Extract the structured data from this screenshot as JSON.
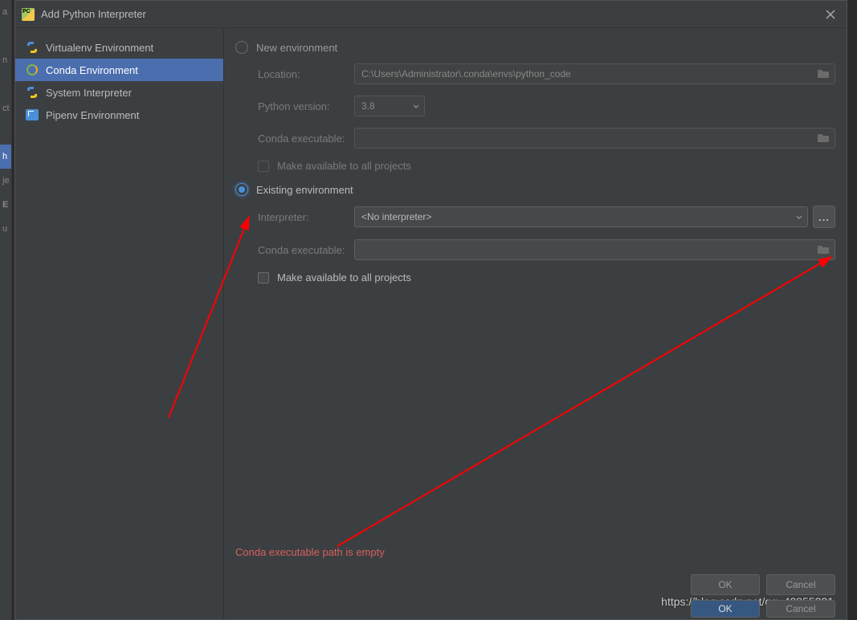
{
  "title": "Add Python Interpreter",
  "sidebar": {
    "items": [
      {
        "label": "Virtualenv Environment"
      },
      {
        "label": "Conda Environment"
      },
      {
        "label": "System Interpreter"
      },
      {
        "label": "Pipenv Environment"
      }
    ]
  },
  "radio": {
    "new_env": "New environment",
    "existing_env": "Existing environment"
  },
  "form": {
    "location_label": "Location:",
    "location_value": "C:\\Users\\Administrator\\.conda\\envs\\python_code",
    "pyver_label": "Python version:",
    "pyver_value": "3.8",
    "conda_exe_label": "Conda executable:",
    "conda_exe_value": "",
    "make_all_label": "Make available to all projects",
    "interpreter_label": "Interpreter:",
    "interpreter_value": "<No interpreter>",
    "conda_exe2_label": "Conda executable:",
    "conda_exe2_value": "",
    "make_all2_label": "Make available to all projects"
  },
  "error": "Conda executable path is empty",
  "buttons": {
    "ok": "OK",
    "cancel": "Cancel"
  },
  "ellipsis": "...",
  "watermark": "https://blog.csdn.net/qq_42855221"
}
